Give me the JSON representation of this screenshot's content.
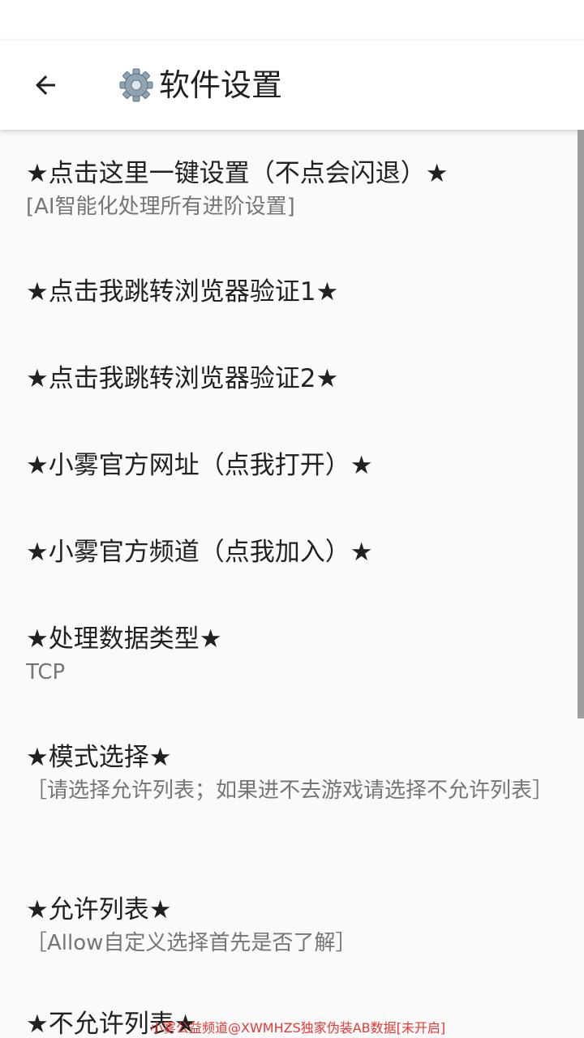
{
  "header": {
    "title": "软件设置",
    "back_icon": "arrow-left-icon",
    "title_icon": "gear-icon"
  },
  "items": [
    {
      "title": "★点击这里一键设置（不点会闪退）★",
      "summary": "[AI智能化处理所有进阶设置]"
    },
    {
      "title": "★点击我跳转浏览器验证1★"
    },
    {
      "title": "★点击我跳转浏览器验证2★"
    },
    {
      "title": "★小雾官方网址（点我打开）★"
    },
    {
      "title": "★小雾官方频道（点我加入）★"
    },
    {
      "title": "★处理数据类型★",
      "summary": "TCP"
    },
    {
      "title": "★模式选择★",
      "summary": "［请选择允许列表；如果进不去游戏请选择不允许列表］"
    },
    {
      "title": "★允许列表★",
      "summary": "［Allow自定义选择首先是否了解］"
    },
    {
      "title": "★不允许列表★"
    }
  ],
  "watermark": "小雾公益频道@XWMHZS独家伪装AB数据[未开启]",
  "colors": {
    "background": "#fafafa",
    "app_bar": "#ffffff",
    "title_text": "#212121",
    "summary_text": "#757575",
    "scrollbar": "#9e9e9e",
    "watermark": "#e53935"
  }
}
